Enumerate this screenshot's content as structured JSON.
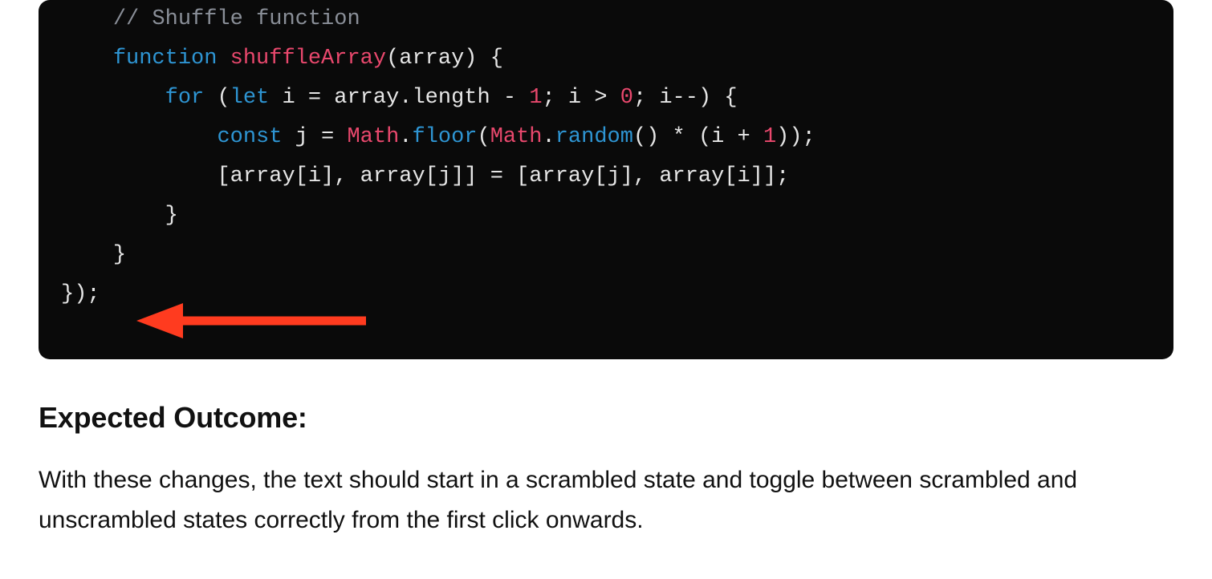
{
  "code": {
    "comment": "// Shuffle function",
    "fn_kw": "function",
    "fn_name": "shuffleArray",
    "fn_sig_rest": "(array) {",
    "for_kw": "for",
    "let_kw": "let",
    "for_after_let": " i = array.length - ",
    "num_one_a": "1",
    "for_mid": "; i > ",
    "num_zero": "0",
    "for_tail": "; i--) {",
    "const_kw": "const",
    "after_const": " j = ",
    "math_a": "Math",
    "dot_a": ".",
    "floor": "floor",
    "paren_open_a": "(",
    "math_b": "Math",
    "dot_b": ".",
    "random": "random",
    "after_random": "() * (i + ",
    "num_one_b": "1",
    "line3_end": "));",
    "swap_line": "[array[i], array[j]] = [array[j], array[i]];",
    "close_for": "}",
    "close_fn": "}",
    "close_outer": "});"
  },
  "section": {
    "heading": "Expected Outcome:",
    "body": "With these changes, the text should start in a scrambled state and toggle between scrambled and unscrambled states correctly from the first click onwards."
  },
  "annotation": {
    "arrow_color": "#ff3b1f"
  }
}
